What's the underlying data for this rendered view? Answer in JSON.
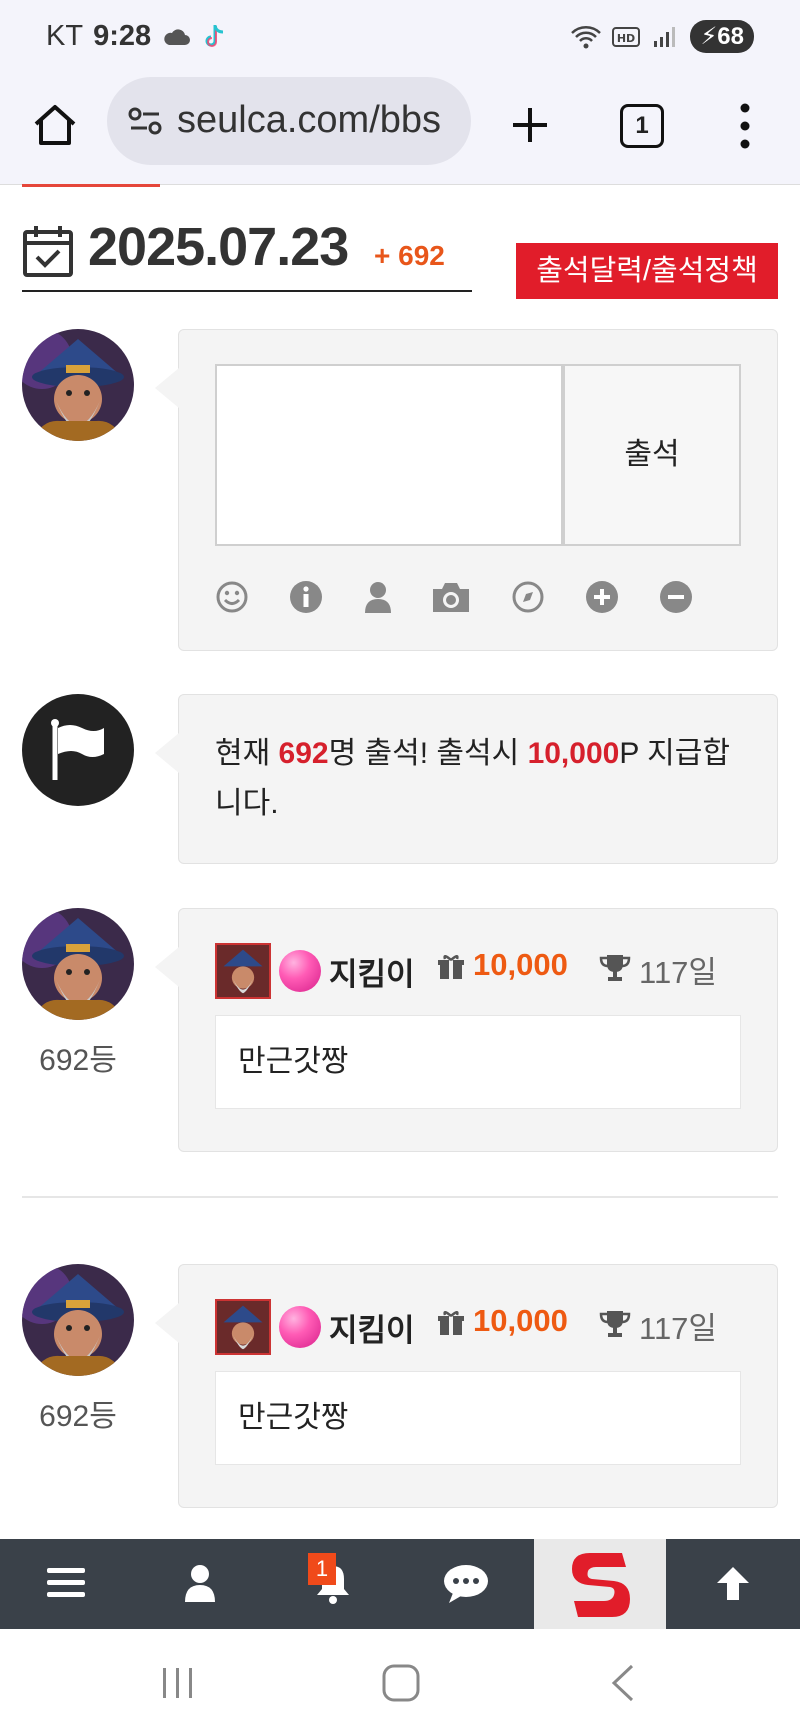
{
  "status_bar": {
    "carrier": "KT",
    "time": "9:28",
    "battery": "68"
  },
  "browser": {
    "url": "seulca.com/bbs",
    "tab_count": "1"
  },
  "attendance": {
    "date": "2025.07.23",
    "count_label": "+ 692",
    "policy_button": "출석달력/출석정책",
    "attend_button": "출석",
    "comment_value": ""
  },
  "toolbar_icons": [
    "smile-icon",
    "info-icon",
    "user-icon",
    "camera-icon",
    "compass-icon",
    "plus-circle-icon",
    "minus-circle-icon"
  ],
  "notice": {
    "prefix": "현재 ",
    "count": "692",
    "mid": "명 출석! 출석시 ",
    "points": "10,000",
    "suffix": "P 지급합니다."
  },
  "entries": [
    {
      "rank": "692등",
      "username": "지킴이",
      "points": "10,000",
      "days": "117일",
      "message": "만근갓짱"
    },
    {
      "rank": "692등",
      "username": "지킴이",
      "points": "10,000",
      "days": "117일",
      "message": "만근갓짱"
    }
  ],
  "bottom_nav": {
    "notification_count": "1"
  },
  "colors": {
    "accent_red": "#e11d2a",
    "points_orange": "#ee5a12",
    "nav_bg": "#3a4149"
  }
}
